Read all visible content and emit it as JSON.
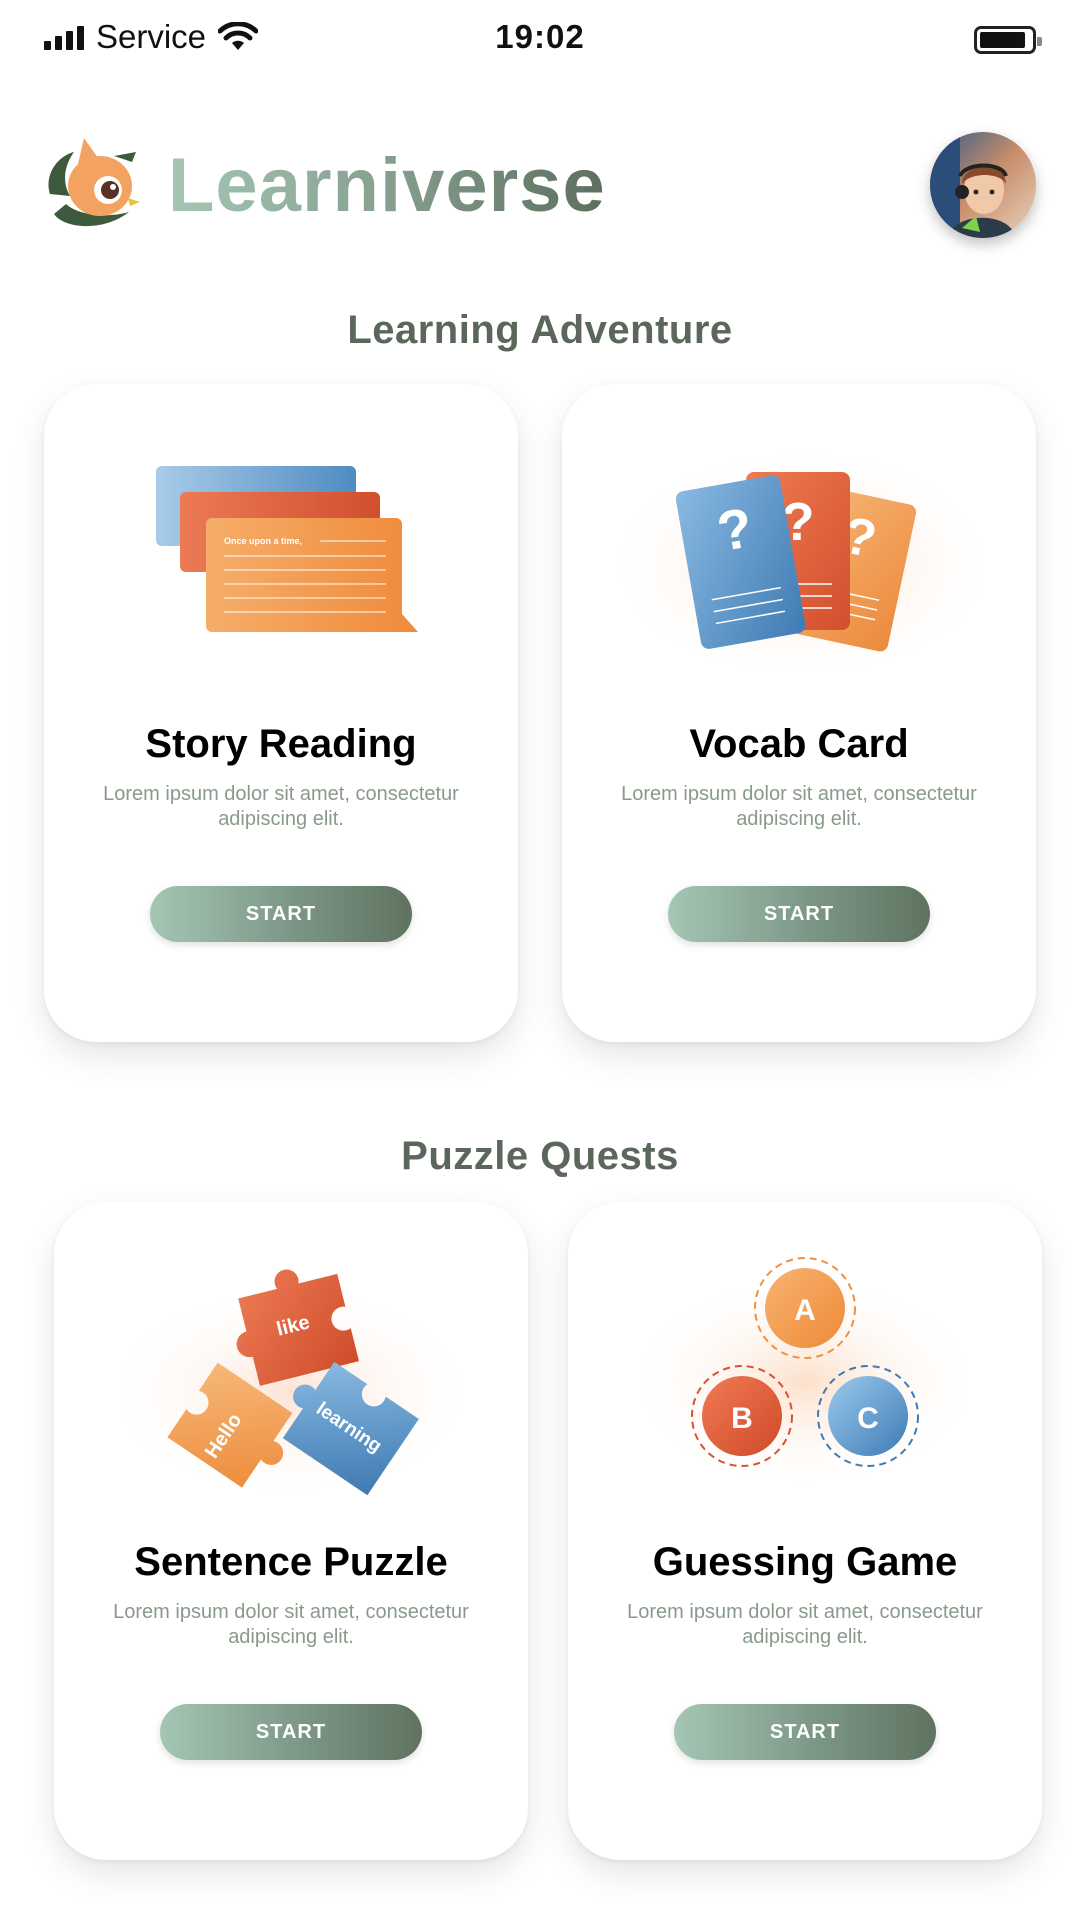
{
  "status_bar": {
    "carrier": "Service",
    "time": "19:02"
  },
  "header": {
    "brand": "Learniverse"
  },
  "sections": [
    {
      "title": "Learning Adventure",
      "cards": [
        {
          "title": "Story Reading",
          "description": "Lorem ipsum dolor sit amet, consectetur adipiscing elit.",
          "button": "START",
          "illustration_text": "Once upon a time,"
        },
        {
          "title": "Vocab Card",
          "description": "Lorem ipsum dolor sit amet, consectetur adipiscing elit.",
          "button": "START",
          "illustration_text": "?"
        }
      ]
    },
    {
      "title": "Puzzle Quests",
      "cards": [
        {
          "title": "Sentence Puzzle",
          "description": "Lorem ipsum dolor sit amet, consectetur adipiscing elit.",
          "button": "START",
          "pieces": [
            "like",
            "Hello",
            "learning"
          ]
        },
        {
          "title": "Guessing Game",
          "description": "Lorem ipsum dolor sit amet, consectetur adipiscing elit.",
          "button": "START",
          "options": [
            "A",
            "B",
            "C"
          ]
        }
      ]
    }
  ],
  "colors": {
    "brand_green": "#6b7d6b",
    "orange": "#f0923e",
    "red_orange": "#e06040",
    "blue": "#5b9bd0"
  }
}
